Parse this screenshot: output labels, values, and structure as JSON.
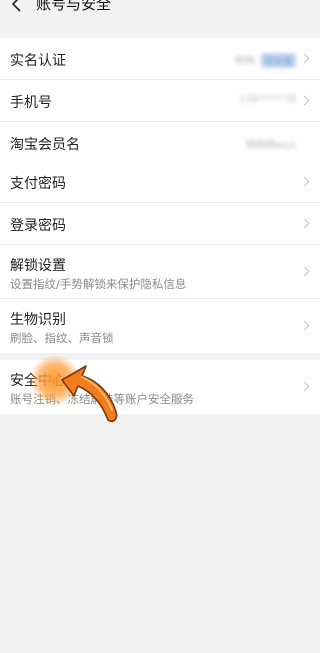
{
  "header": {
    "title": "账号与安全"
  },
  "group1": {
    "items": [
      {
        "label": "实名认证",
        "value": "韩韩",
        "badge": "已认证"
      },
      {
        "label": "手机号",
        "value": "138*****78"
      },
      {
        "label": "淘宝会员名",
        "value": "韩韩韩wyx"
      }
    ]
  },
  "group2": {
    "items": [
      {
        "label": "支付密码"
      },
      {
        "label": "登录密码"
      },
      {
        "label": "解锁设置",
        "sub": "设置指纹/手势解锁来保护隐私信息"
      },
      {
        "label": "生物识别",
        "sub": "刷脸、指纹、声音锁"
      }
    ]
  },
  "group3": {
    "items": [
      {
        "label": "安全中心",
        "sub": "账号注销、冻结解挂等账户安全服务"
      }
    ]
  },
  "colors": {
    "background": "#f2f2f2",
    "card": "#ffffff",
    "pointer": "#f07d1e",
    "badge": "#bfd3f0"
  },
  "icons": {
    "back": "chevron-left-icon",
    "row_arrow": "chevron-right-icon",
    "tap_pointer": "hand-drawn-arrow-icon"
  }
}
